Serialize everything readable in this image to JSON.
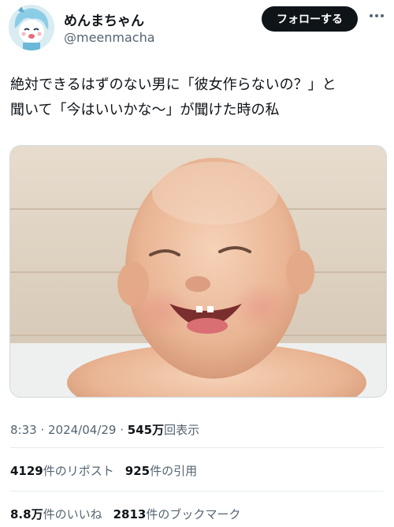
{
  "user": {
    "display_name": "めんまちゃん",
    "handle": "@meenmacha",
    "follow_label": "フォローする"
  },
  "icons": {
    "more": "more-horizontal-icon",
    "avatar": "anime-character-avatar"
  },
  "tweet": {
    "text_line1": "絶対できるはずのない男に「彼女作らないの？」と",
    "text_line2": "聞いて「今はいいかな〜」が聞けた時の私",
    "image_alt": "laughing chubby baby in a bathtub"
  },
  "meta": {
    "time": "8:33",
    "sep1": " · ",
    "date": "2024/04/29",
    "sep2": " · ",
    "views_count": "545万",
    "views_label": "回表示"
  },
  "stats": {
    "reposts_count": "4129",
    "reposts_label": "件のリポスト",
    "quotes_count": "925",
    "quotes_label": "件の引用",
    "likes_count": "8.8万",
    "likes_label": "件のいいね",
    "bookmarks_count": "2813",
    "bookmarks_label": "件のブックマーク"
  },
  "colors": {
    "text": "#0f1419",
    "secondary": "#536471",
    "button_bg": "#0f1419",
    "divider": "#e6ecf0"
  }
}
